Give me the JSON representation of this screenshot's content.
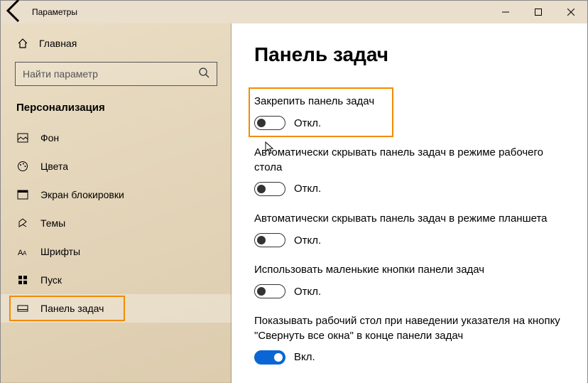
{
  "window": {
    "title": "Параметры"
  },
  "sidebar": {
    "home": "Главная",
    "search_placeholder": "Найти параметр",
    "category": "Персонализация",
    "items": [
      {
        "label": "Фон"
      },
      {
        "label": "Цвета"
      },
      {
        "label": "Экран блокировки"
      },
      {
        "label": "Темы"
      },
      {
        "label": "Шрифты"
      },
      {
        "label": "Пуск"
      },
      {
        "label": "Панель задач"
      }
    ]
  },
  "main": {
    "heading": "Панель задач",
    "settings": [
      {
        "label": "Закрепить панель задач",
        "state": "Откл.",
        "on": false
      },
      {
        "label": "Автоматически скрывать панель задач в режиме рабочего стола",
        "state": "Откл.",
        "on": false
      },
      {
        "label": "Автоматически скрывать панель задач в режиме планшета",
        "state": "Откл.",
        "on": false
      },
      {
        "label": "Использовать маленькие кнопки панели задач",
        "state": "Откл.",
        "on": false
      },
      {
        "label": "Показывать рабочий стол при наведении указателя на кнопку \"Свернуть все окна\" в конце панели задач",
        "state": "Вкл.",
        "on": true
      }
    ]
  }
}
